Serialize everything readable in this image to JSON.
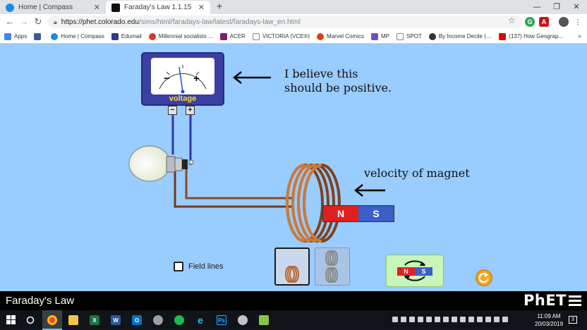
{
  "browser": {
    "tabs": [
      {
        "title": "Home | Compass",
        "color": "#1e88e5"
      },
      {
        "title": "Faraday's Law 1.1.15",
        "color": "#111111"
      }
    ],
    "new_tab": "+",
    "window_controls": {
      "minimize": "—",
      "restore": "❐",
      "close": "✕"
    },
    "nav": {
      "back": "←",
      "forward": "→",
      "reload": "↻"
    },
    "url": {
      "host": "https://phet.colorado.edu",
      "path": "/sims/html/faradays-law/latest/faradays-law_en.html"
    },
    "bookmark_star": "☆"
  },
  "bookmarks": [
    {
      "label": "Apps",
      "color": "#4285f4"
    },
    {
      "label": "",
      "color": "#3b5998"
    },
    {
      "label": "Home | Compass",
      "color": "#1e88e5"
    },
    {
      "label": "Edumail",
      "color": "#2f3b8f"
    },
    {
      "label": "Millennial socialists ...",
      "color": "#d9372c"
    },
    {
      "label": "ACER",
      "color": "#7b1f6b"
    },
    {
      "label": "VICTORIA (VCE®)",
      "color": "#888888"
    },
    {
      "label": "Marvel Comics",
      "color": "#e23b1e"
    },
    {
      "label": "MP",
      "color": "#7050c0"
    },
    {
      "label": "SPOT",
      "color": "#888888"
    },
    {
      "label": "By Income Decile | ...",
      "color": "#333333"
    },
    {
      "label": "(137) How Geograp...",
      "color": "#e00000"
    }
  ],
  "bookmarks_more": "»",
  "annotations": {
    "voltmeter_note_line1": "I believe this",
    "voltmeter_note_line2": "should be positive.",
    "velocity_note": "velocity of magnet"
  },
  "simulation": {
    "voltmeter_label": "voltage",
    "dial_minus": "−",
    "dial_plus": "+",
    "terminal_minus": "−",
    "terminal_plus": "+",
    "magnet_north": "N",
    "magnet_south": "S",
    "flip_north": "N",
    "flip_south": "S",
    "field_lines_label": "Field lines",
    "field_lines_checked": false,
    "selected_coil": 1,
    "needle_deflection": "slightly negative"
  },
  "navbar": {
    "title": "Faraday's Law",
    "logo": "PhET"
  },
  "taskbar": {
    "clock_time": "11:09 AM",
    "clock_date": "20/03/2019",
    "notification_count": "3"
  },
  "colors": {
    "sim_background": "#99ccff",
    "magnet_north": "#e02020",
    "magnet_south": "#3a5fc6",
    "coil_copper": "#b8642a",
    "voltmeter_body": "#3b3fa3"
  }
}
